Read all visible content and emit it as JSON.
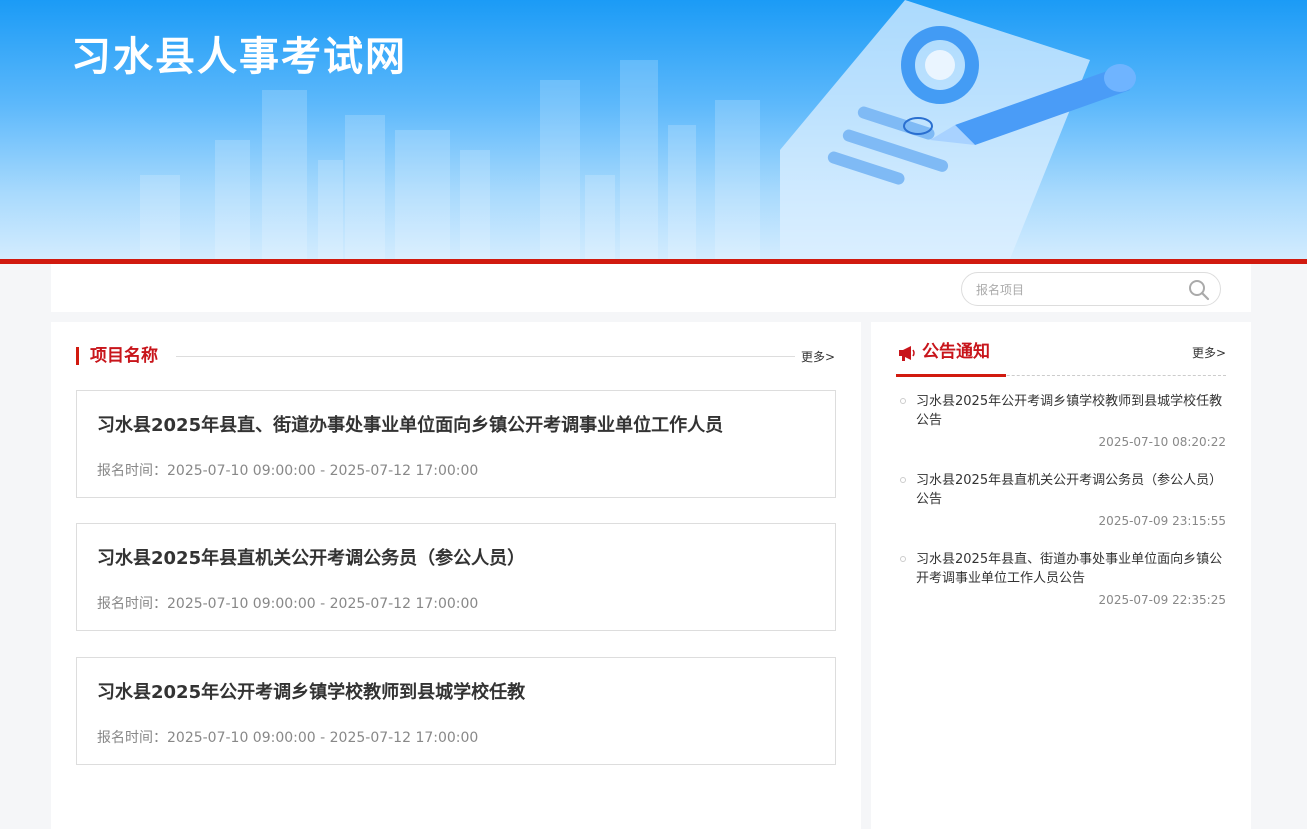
{
  "header": {
    "site_title": "习水县人事考试网"
  },
  "search": {
    "placeholder": "报名项目"
  },
  "projects": {
    "section_title": "项目名称",
    "more_label": "更多>",
    "items": [
      {
        "title": "习水县2025年县直、街道办事处事业单位面向乡镇公开考调事业单位工作人员",
        "time": "报名时间：2025-07-10 09:00:00 - 2025-07-12 17:00:00"
      },
      {
        "title": "习水县2025年县直机关公开考调公务员（参公人员）",
        "time": "报名时间：2025-07-10 09:00:00 - 2025-07-12 17:00:00"
      },
      {
        "title": "习水县2025年公开考调乡镇学校教师到县城学校任教",
        "time": "报名时间：2025-07-10 09:00:00 - 2025-07-12 17:00:00"
      }
    ]
  },
  "notices": {
    "section_title": "公告通知",
    "more_label": "更多>",
    "items": [
      {
        "title": "习水县2025年公开考调乡镇学校教师到县城学校任教公告",
        "date": "2025-07-10 08:20:22"
      },
      {
        "title": "习水县2025年县直机关公开考调公务员（参公人员）公告",
        "date": "2025-07-09 23:15:55"
      },
      {
        "title": "习水县2025年县直、街道办事处事业单位面向乡镇公开考调事业单位工作人员公告",
        "date": "2025-07-09 22:35:25"
      }
    ]
  },
  "colors": {
    "accent_red": "#d11a0f",
    "banner_blue": "#1b9bf6"
  },
  "icons": {
    "search": "search-icon",
    "notice": "megaphone-icon"
  }
}
